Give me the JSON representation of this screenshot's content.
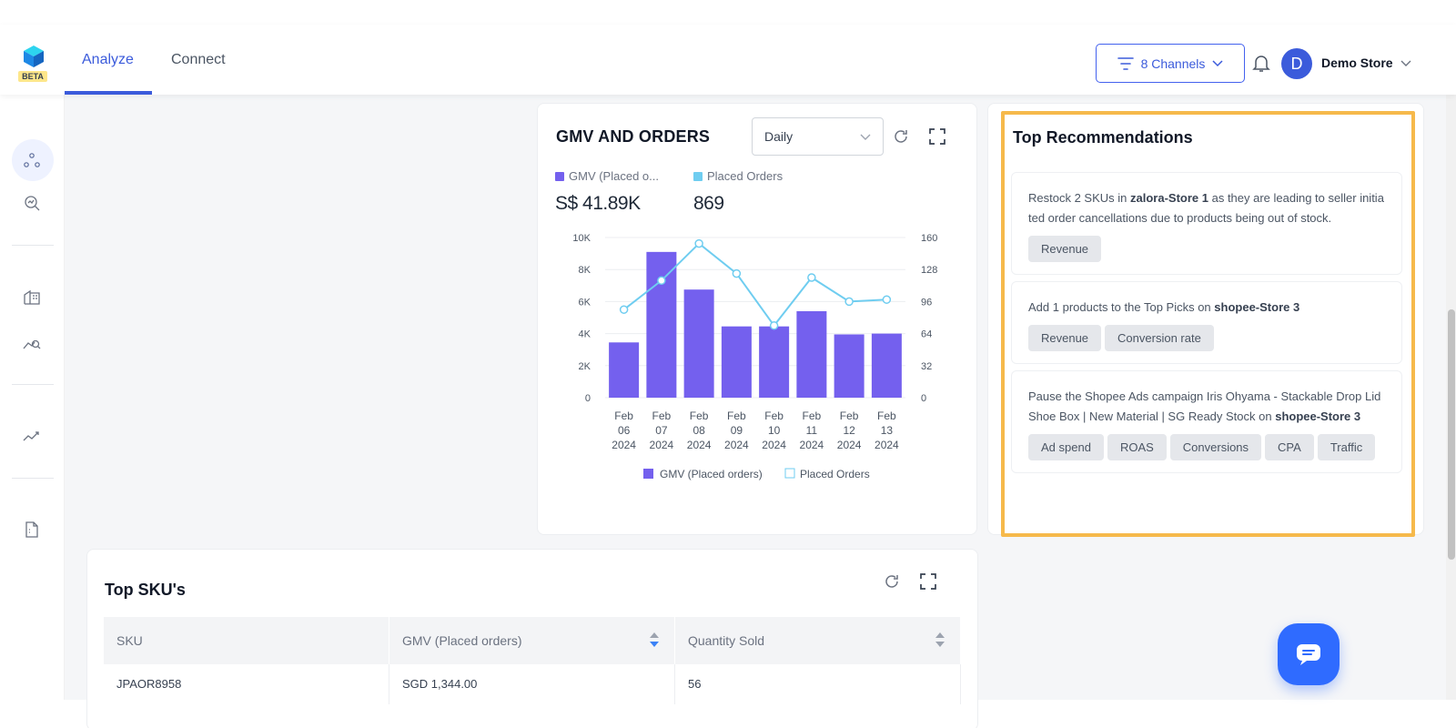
{
  "header": {
    "beta": "BETA",
    "tabs": [
      {
        "label": "Analyze",
        "active": true
      },
      {
        "label": "Connect",
        "active": false
      }
    ],
    "channels_label": "8 Channels",
    "avatar_initial": "D",
    "store_name": "Demo Store"
  },
  "sidebar": {
    "icons": [
      "nodes-icon",
      "search-chart-icon",
      "store-icon",
      "analytics-search-icon",
      "trend-icon",
      "document-icon"
    ]
  },
  "gmv_card": {
    "title": "GMV AND ORDERS",
    "period": "Daily",
    "legend_gmv": "GMV (Placed o...",
    "legend_orders": "Placed Orders",
    "gmv_value": "S$ 41.89K",
    "orders_value": "869",
    "chart_legend_gmv": "GMV (Placed orders)",
    "chart_legend_orders": "Placed Orders"
  },
  "chart_data": {
    "type": "bar",
    "categories": [
      [
        "Feb",
        "06",
        "2024"
      ],
      [
        "Feb",
        "07",
        "2024"
      ],
      [
        "Feb",
        "08",
        "2024"
      ],
      [
        "Feb",
        "09",
        "2024"
      ],
      [
        "Feb",
        "10",
        "2024"
      ],
      [
        "Feb",
        "11",
        "2024"
      ],
      [
        "Feb",
        "12",
        "2024"
      ],
      [
        "Feb",
        "13",
        "2024"
      ]
    ],
    "series": [
      {
        "name": "GMV (Placed orders)",
        "type": "bar",
        "axis": "left",
        "values": [
          3450,
          9100,
          6750,
          4450,
          4450,
          5400,
          3950,
          4000
        ],
        "color": "#7460ee"
      },
      {
        "name": "Placed Orders",
        "type": "line",
        "axis": "right",
        "values": [
          88,
          117,
          154,
          124,
          72,
          120,
          96,
          98
        ],
        "color": "#6fcdf0"
      }
    ],
    "left_ticks": [
      "0",
      "2K",
      "4K",
      "6K",
      "8K",
      "10K"
    ],
    "right_ticks": [
      "0",
      "32",
      "64",
      "96",
      "128",
      "160"
    ],
    "ylim_left": [
      0,
      10000
    ],
    "ylim_right": [
      0,
      160
    ],
    "grid": true,
    "legend": "bottom"
  },
  "recommendations": {
    "title": "Top Recommendations",
    "items": [
      {
        "pre": "Restock 2 SKUs in ",
        "bold": "zalora-Store 1",
        "post": " as they are leading to seller initiated order cancellations due to products being out of stock.",
        "tags": [
          "Revenue"
        ]
      },
      {
        "pre": "Add 1 products to the Top Picks on ",
        "bold": "shopee-Store 3",
        "post": "",
        "tags": [
          "Revenue",
          "Conversion rate"
        ]
      },
      {
        "pre": "Pause the Shopee Ads campaign Iris Ohyama - Stackable Drop Lid Shoe Box | New Material | SG Ready Stock on ",
        "bold": "shopee-Store 3",
        "post": "",
        "tags": [
          "Ad spend",
          "ROAS",
          "Conversions",
          "CPA",
          "Traffic"
        ]
      }
    ]
  },
  "sku_card": {
    "title": "Top SKU's",
    "headers": [
      "SKU",
      "GMV (Placed orders)",
      "Quantity Sold"
    ],
    "rows": [
      [
        "JPAOR8958",
        "SGD 1,344.00",
        "56"
      ]
    ]
  }
}
